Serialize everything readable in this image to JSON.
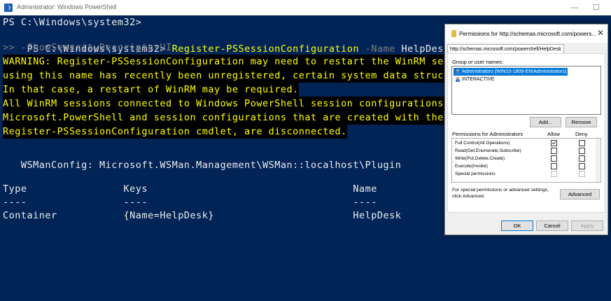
{
  "window": {
    "title": "Administrator: Windows PowerShell",
    "minimize": "—",
    "maximize": "☐"
  },
  "console": {
    "lines": [
      {
        "text": "PS C:\\Windows\\system32>"
      },
      {
        "prompt": "PS C:\\Windows\\system32> ",
        "cmdlet": "Register-PSSessionConfiguration",
        "param": " -Name",
        "arg": " HelpDesk `"
      },
      {
        "text": ">> -ShowSecurityDescriptorUI"
      },
      {
        "text": "WARNING: Register-PSSessionConfiguration may need to restart the WinRM ser"
      },
      {
        "text": "using this name has recently been unregistered, certain system data struct"
      },
      {
        "text": "In that case, a restart of WinRM may be required."
      },
      {
        "text": "All WinRM sessions connected to Windows PowerShell session configurations,"
      },
      {
        "text": "Microsoft.PowerShell and session configurations that are created with the"
      },
      {
        "text": "Register-PSSessionConfiguration cmdlet, are disconnected."
      },
      {
        "text": "   WSManConfig: Microsoft.WSMan.Management\\WSMan::localhost\\Plugin"
      },
      {
        "text": "Type                Keys                                  Name"
      },
      {
        "text": "----                ----                                  ----"
      },
      {
        "text": "Container           {Name=HelpDesk}                       HelpDesk"
      }
    ]
  },
  "dialog": {
    "title": "Permissions for http://schemas.microsoft.com/powers...",
    "close": "✕",
    "tab_label": "http://schemas.microsoft.com/powershell/HelpDesk",
    "group_label": "Group or user names:",
    "users": [
      {
        "name": "Administrators (WIN10-1809-EN\\Administrators)",
        "selected": true
      },
      {
        "name": "INTERACTIVE",
        "selected": false
      }
    ],
    "add_button": "Add...",
    "remove_button": "Remove",
    "permissions_label": "Permissions for Administrators",
    "allow_header": "Allow",
    "deny_header": "Deny",
    "permissions": [
      {
        "name": "Full Control(All Operations)",
        "allow": true,
        "deny": false,
        "disabled": false
      },
      {
        "name": "Read(Get,Enumerate,Subscribe)",
        "allow": false,
        "deny": false,
        "disabled": false
      },
      {
        "name": "Write(Put,Delete,Create)",
        "allow": false,
        "deny": false,
        "disabled": false
      },
      {
        "name": "Execute(Invoke)",
        "allow": false,
        "deny": false,
        "disabled": false
      },
      {
        "name": "Special permissions",
        "allow": false,
        "deny": false,
        "disabled": true
      }
    ],
    "special_note_1": "For special permissions or advanced settings,",
    "special_note_2": "click Advanced.",
    "advanced_button": "Advanced",
    "ok_button": "OK",
    "cancel_button": "Cancel",
    "apply_button": "Apply"
  },
  "colors": {
    "console_bg": "#012456",
    "console_text": "#eeedf0",
    "cmdlet": "#ffff00",
    "param": "#7f7f7f",
    "warning_text": "#ffff00",
    "warning_bg": "#000000",
    "selection": "#0078d7"
  }
}
